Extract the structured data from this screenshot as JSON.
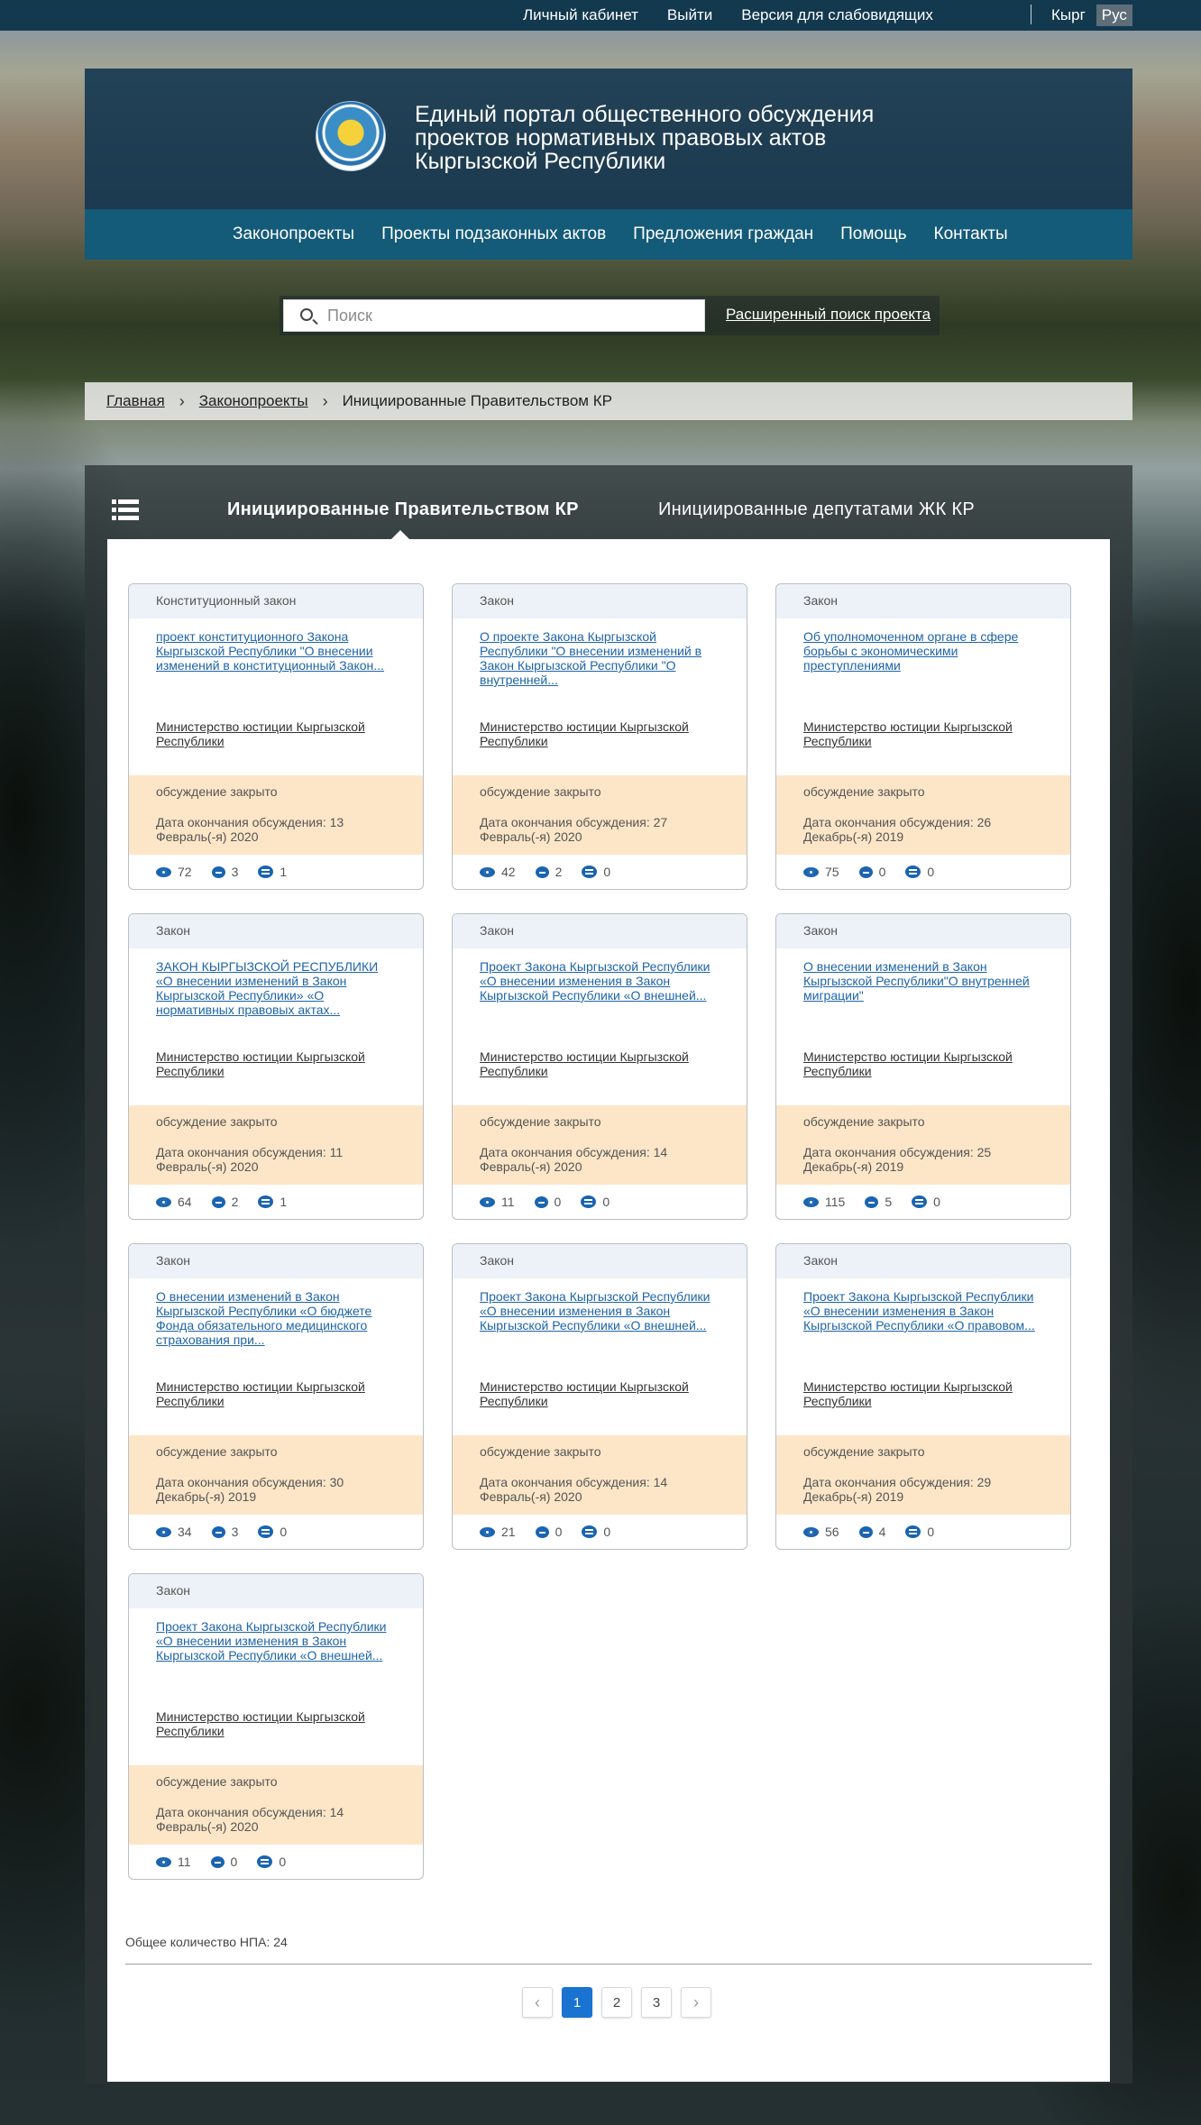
{
  "topbar": {
    "links": [
      "Личный кабинет",
      "Выйти",
      "Версия для слабовидящих"
    ],
    "lang": [
      "Кырг",
      "Рус"
    ],
    "active_lang": "Рус"
  },
  "header": {
    "title_lines": [
      "Единый портал общественного обсуждения",
      "проектов нормативных правовых актов",
      "Кыргызской Республики"
    ]
  },
  "nav": [
    "Законопроекты",
    "Проекты подзаконных актов",
    "Предложения граждан",
    "Помощь",
    "Контакты"
  ],
  "search": {
    "placeholder": "Поиск",
    "advanced_label": "Расширенный поиск проекта"
  },
  "breadcrumb": {
    "home": "Главная",
    "section": "Законопроекты",
    "current": "Инициированные Правительством КР"
  },
  "tabs": {
    "active": "Инициированные Правительством КР",
    "other": "Инициированные депутатами ЖК КР"
  },
  "cards": [
    {
      "type": "Конституционный закон",
      "title": "проект конституционного Закона Кыргызской Республики \"О внесении изменений в конституционный Закон...",
      "org": "Министерство юстиции Кыргызской Республики",
      "status": "обсуждение закрыто",
      "deadline": "Дата окончания обсуждения: 13 Февраль(-я) 2020",
      "views": "72",
      "comments": "3",
      "replies": "1"
    },
    {
      "type": "Закон",
      "title": "О проекте Закона Кыргызской Республики \"О внесении изменений в Закон Кыргызской Республики \"О внутренней...",
      "org": "Министерство юстиции Кыргызской Республики",
      "status": "обсуждение закрыто",
      "deadline": "Дата окончания обсуждения: 27 Февраль(-я) 2020",
      "views": "42",
      "comments": "2",
      "replies": "0"
    },
    {
      "type": "Закон",
      "title": "Об уполномоченном органе в сфере борьбы с экономическими преступлениями",
      "org": "Министерство юстиции Кыргызской Республики",
      "status": "обсуждение закрыто",
      "deadline": "Дата окончания обсуждения: 26 Декабрь(-я) 2019",
      "views": "75",
      "comments": "0",
      "replies": "0"
    },
    {
      "type": "Закон",
      "title": "ЗАКОН КЫРГЫЗСКОЙ РЕСПУБЛИКИ «О внесении изменений в Закон Кыргызской Республики» «О нормативных правовых актах...",
      "org": "Министерство юстиции Кыргызской Республики",
      "status": "обсуждение закрыто",
      "deadline": "Дата окончания обсуждения: 11 Февраль(-я) 2020",
      "views": "64",
      "comments": "2",
      "replies": "1"
    },
    {
      "type": "Закон",
      "title": "Проект Закона Кыргызской Республики «О внесении изменения в Закон Кыргызской Республики «О внешней...",
      "org": "Министерство юстиции Кыргызской Республики",
      "status": "обсуждение закрыто",
      "deadline": "Дата окончания обсуждения: 14 Февраль(-я) 2020",
      "views": "11",
      "comments": "0",
      "replies": "0"
    },
    {
      "type": "Закон",
      "title": "О внесении изменений в Закон Кыргызской Республики\"О внутренней миграции\"",
      "org": "Министерство юстиции Кыргызской Республики",
      "status": "обсуждение закрыто",
      "deadline": "Дата окончания обсуждения: 25 Декабрь(-я) 2019",
      "views": "115",
      "comments": "5",
      "replies": "0"
    },
    {
      "type": "Закон",
      "title": "О внесении изменений в Закон Кыргызской Республики «О бюджете Фонда обязательного медицинского страхования при...",
      "org": "Министерство юстиции Кыргызской Республики",
      "status": "обсуждение закрыто",
      "deadline": "Дата окончания обсуждения: 30 Декабрь(-я) 2019",
      "views": "34",
      "comments": "3",
      "replies": "0"
    },
    {
      "type": "Закон",
      "title": "Проект Закона Кыргызской Республики «О внесении изменения в Закон Кыргызской Республики «О внешней...",
      "org": "Министерство юстиции Кыргызской Республики",
      "status": "обсуждение закрыто",
      "deadline": "Дата окончания обсуждения: 14 Февраль(-я) 2020",
      "views": "21",
      "comments": "0",
      "replies": "0"
    },
    {
      "type": "Закон",
      "title": "Проект Закона Кыргызской Республики «О внесении изменения в Закон Кыргызской Республики «О правовом...",
      "org": "Министерство юстиции Кыргызской Республики",
      "status": "обсуждение закрыто",
      "deadline": "Дата окончания обсуждения: 29 Декабрь(-я) 2019",
      "views": "56",
      "comments": "4",
      "replies": "0"
    },
    {
      "type": "Закон",
      "title": "Проект Закона Кыргызской Республики «О внесении изменения в Закон Кыргызской Республики «О внешней...",
      "org": "Министерство юстиции Кыргызской Республики",
      "status": "обсуждение закрыто",
      "deadline": "Дата окончания обсуждения: 14 Февраль(-я) 2020",
      "views": "11",
      "comments": "0",
      "replies": "0"
    }
  ],
  "total_label": "Общее количество НПА: 24",
  "pagination": {
    "pages": [
      "1",
      "2",
      "3"
    ],
    "current": "1",
    "prev_icon": "chevron-left-icon",
    "next_icon": "chevron-right-icon"
  }
}
